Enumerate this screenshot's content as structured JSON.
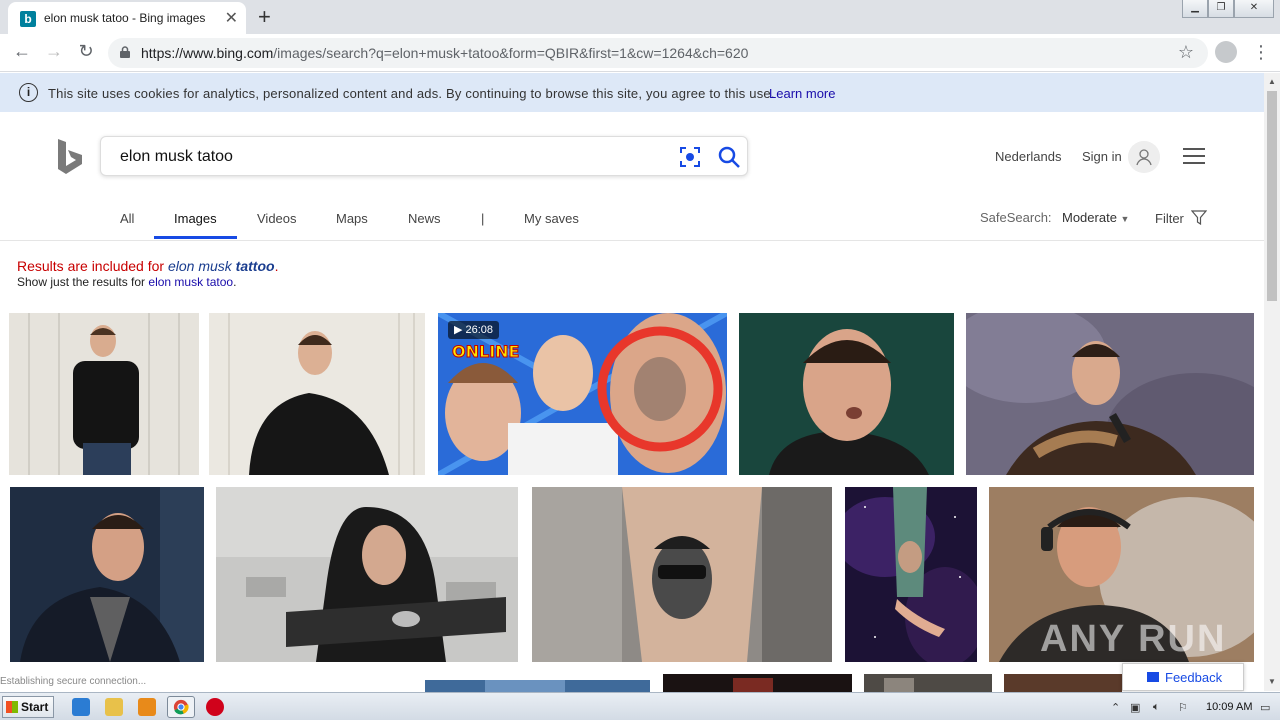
{
  "browser": {
    "tab_title": "elon musk tatoo - Bing images",
    "tab_favicon": "b",
    "new_tab_symbol": "+",
    "close_symbol": "✕",
    "url_domain": "https://www.bing.com",
    "url_rest": "/images/search?q=elon+musk+tatoo&form=QBIR&first=1&cw=1264&ch=620",
    "status_text": "Establishing secure connection..."
  },
  "cookie_banner": {
    "message": "This site uses cookies for analytics, personalized content and ads. By continuing to browse this site, you agree to this use.",
    "learn_more": "Learn more"
  },
  "header": {
    "search_query": "elon musk tatoo",
    "language_link": "Nederlands",
    "sign_in": "Sign in"
  },
  "scopes": {
    "all": "All",
    "images": "Images",
    "videos": "Videos",
    "maps": "Maps",
    "news": "News",
    "separator": "|",
    "my_saves": "My saves",
    "active": "Images"
  },
  "filters": {
    "safesearch_label": "SafeSearch:",
    "safesearch_value": "Moderate",
    "filter_label": "Filter"
  },
  "spelling": {
    "prefix": "Results are included for ",
    "corrected_a": "elon musk ",
    "corrected_b": "tattoo",
    "suffix": ".",
    "show_just": "Show just the results for ",
    "original": "elon musk tatoo",
    "end": "."
  },
  "results": {
    "video_duration": "26:08",
    "video_thumbnail_text": "ONLINE"
  },
  "feedback": {
    "label": "Feedback"
  },
  "watermark": "ANY RUN",
  "taskbar": {
    "start_label": "Start",
    "clock": "10:09 AM"
  },
  "colors": {
    "bing_blue": "#174ae4",
    "spelling_red": "#c80000",
    "link_blue": "#1a0dab",
    "cookie_bg": "#dde8f7"
  }
}
